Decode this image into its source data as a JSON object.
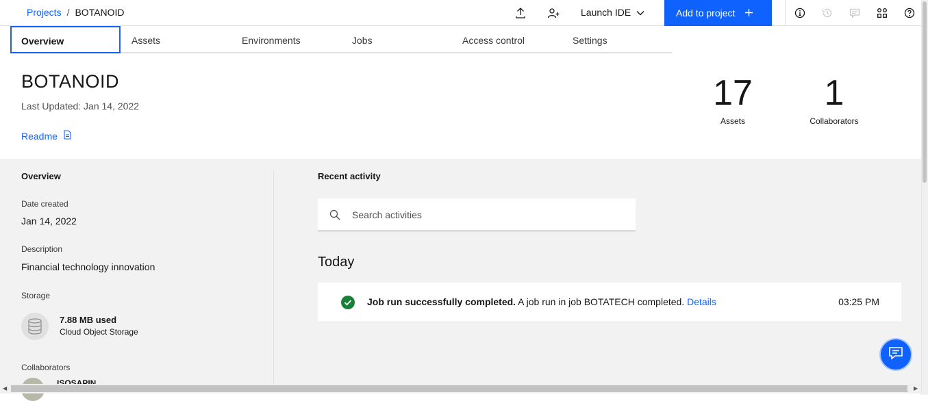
{
  "header": {
    "breadcrumb": {
      "projects": "Projects",
      "separator": "/",
      "current": "BOTANOID"
    },
    "launch_ide": "Launch IDE",
    "add_to_project": "Add to project",
    "icons": [
      "upload-icon",
      "add-user-icon",
      "chevron-down-icon",
      "plus-icon",
      "info-icon",
      "history-icon",
      "comment-icon",
      "apps-icon",
      "help-icon"
    ]
  },
  "tabs": [
    {
      "label": "Overview",
      "active": true
    },
    {
      "label": "Assets"
    },
    {
      "label": "Environments"
    },
    {
      "label": "Jobs"
    },
    {
      "label": "Access control"
    },
    {
      "label": "Settings"
    }
  ],
  "project": {
    "name": "BOTANOID",
    "last_updated": "Last Updated: Jan 14, 2022",
    "readme": "Readme"
  },
  "stats": {
    "assets": {
      "value": "17",
      "label": "Assets"
    },
    "collaborators": {
      "value": "1",
      "label": "Collaborators"
    }
  },
  "overview": {
    "title": "Overview",
    "date_created_label": "Date created",
    "date_created": "Jan 14, 2022",
    "description_label": "Description",
    "description": "Financial technology innovation",
    "storage_label": "Storage",
    "storage_used": "7.88 MB used",
    "storage_type": "Cloud Object Storage",
    "collaborators_label": "Collaborators",
    "collaborator_name": "ISOSAPIN"
  },
  "activity": {
    "title": "Recent activity",
    "search_placeholder": "Search activities",
    "group": "Today",
    "items": [
      {
        "title": "Job run successfully completed.",
        "message": " A job run in job BOTATECH completed. ",
        "link": "Details",
        "time": "03:25 PM"
      }
    ]
  },
  "colors": {
    "primary": "#0f62fe",
    "success": "#198038",
    "surface": "#f2f2f2"
  }
}
